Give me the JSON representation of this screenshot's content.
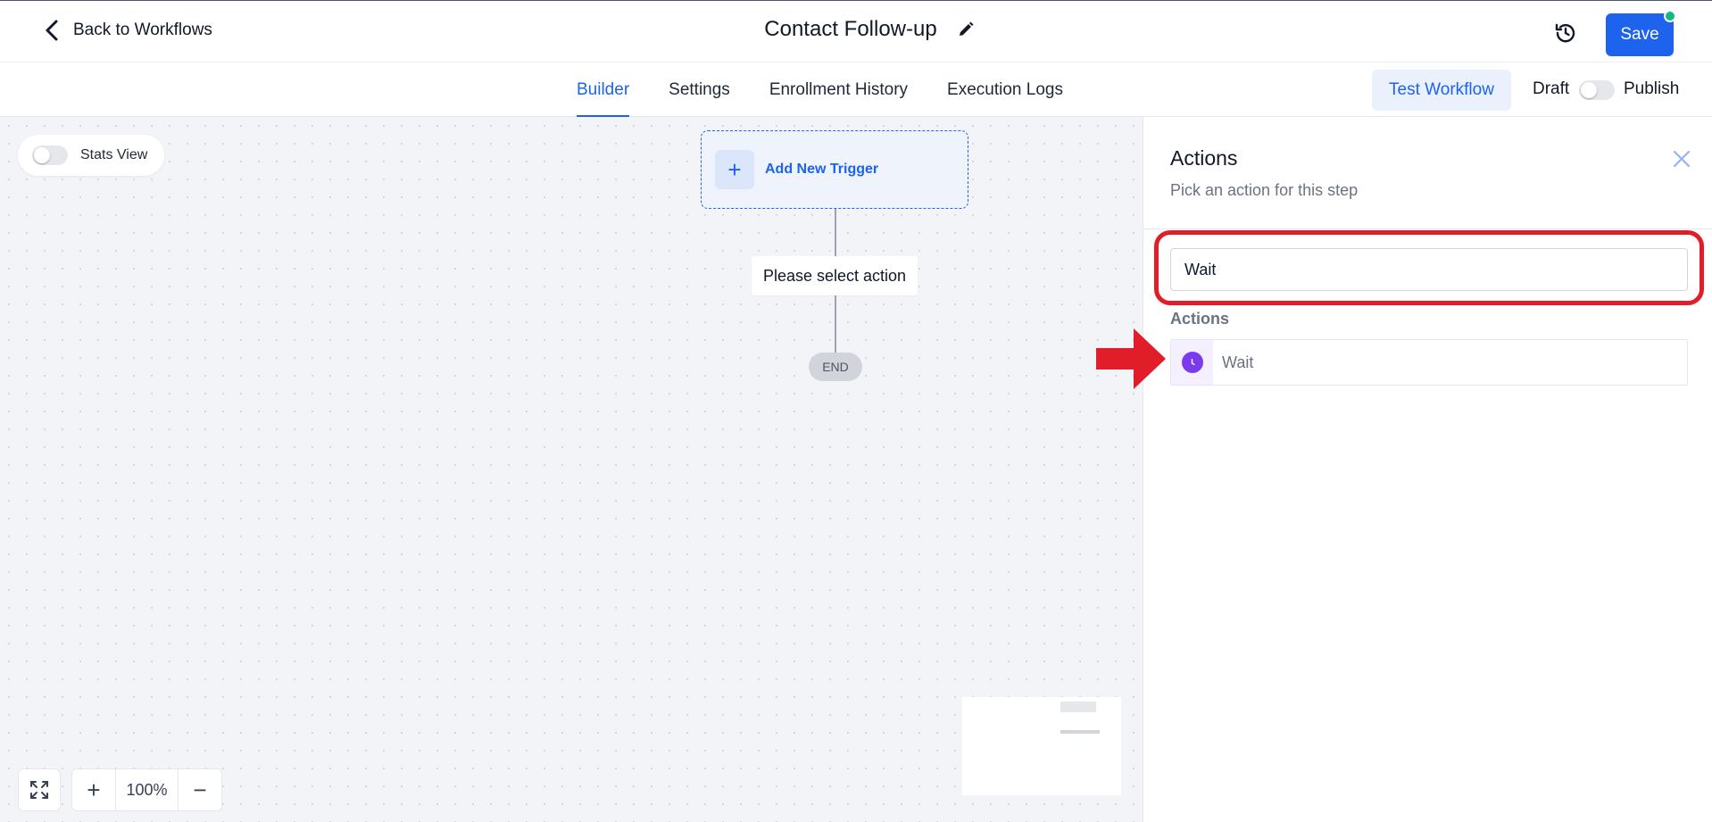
{
  "header": {
    "back_label": "Back to Workflows",
    "title": "Contact Follow-up",
    "save_label": "Save",
    "icons": {
      "back": "chevron-left-icon",
      "edit": "pencil-icon",
      "history": "clock-history-icon"
    },
    "colors": {
      "primary": "#1d63ed",
      "status_dot": "#10b981"
    }
  },
  "tabs": [
    {
      "label": "Builder",
      "active": true
    },
    {
      "label": "Settings",
      "active": false
    },
    {
      "label": "Enrollment History",
      "active": false
    },
    {
      "label": "Execution Logs",
      "active": false
    }
  ],
  "toolbar": {
    "test_workflow_label": "Test Workflow",
    "draft_label": "Draft",
    "publish_label": "Publish",
    "publish_on": false
  },
  "canvas": {
    "stats_view_label": "Stats View",
    "stats_view_on": false,
    "trigger_label": "Add New Trigger",
    "action_placeholder": "Please select action",
    "end_label": "END",
    "zoom_level": "100%",
    "zoom_in_symbol": "+",
    "zoom_out_symbol": "−"
  },
  "panel": {
    "title": "Actions",
    "subtitle": "Pick an action for this step",
    "search_value": "Wait",
    "section_label": "Actions",
    "results": [
      {
        "label": "Wait",
        "icon": "clock-icon",
        "icon_color": "#7c3aed"
      }
    ]
  },
  "annotations": {
    "highlight_color": "#e11d2a"
  }
}
